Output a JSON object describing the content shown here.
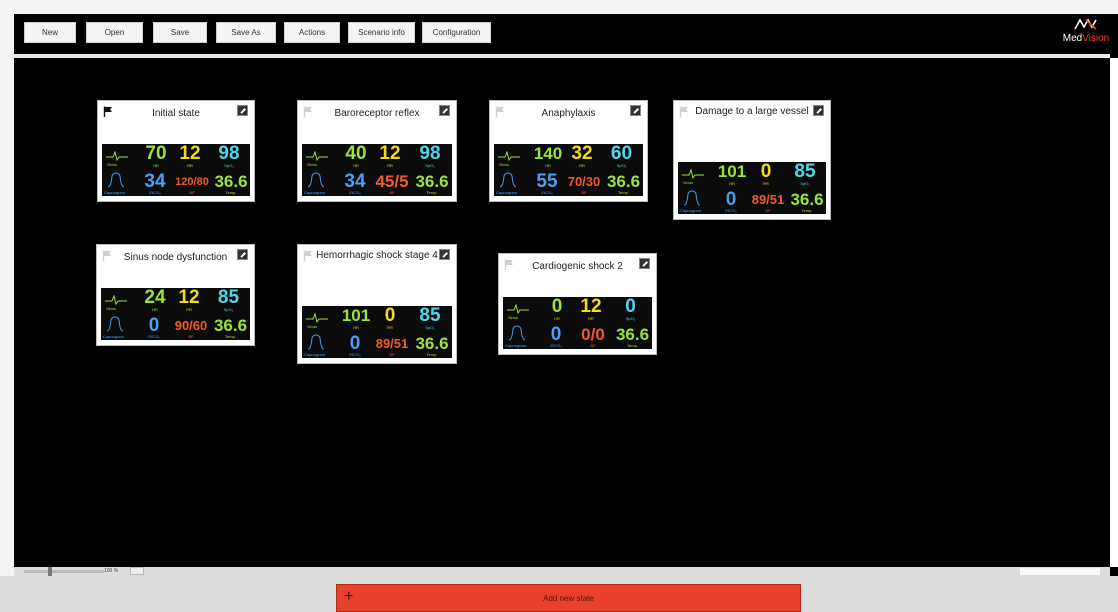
{
  "toolbar": {
    "buttons": [
      "New",
      "Open",
      "Save",
      "Save As",
      "Actions",
      "Scenario info",
      "Configuration"
    ]
  },
  "logo": {
    "text_a": "Med",
    "text_b": "Vision"
  },
  "zoom": {
    "label": "100 %"
  },
  "add_state": {
    "label": "Add new state"
  },
  "monitor_labels": {
    "sinus": "Sinus",
    "capnogram": "Capnogram",
    "hr": "HR",
    "rr": "RR",
    "spo2": "SpO₂",
    "etco2": "EtCO₂",
    "bp": "BP",
    "temp": "Temp."
  },
  "colors": {
    "accent": "#e8402a",
    "hr": "#9be33a",
    "rr": "#f3da1a",
    "spo2": "#4fd6ec",
    "etco2": "#4a9ff5",
    "bp": "#f05a28",
    "temp": "#9be33a"
  },
  "states": [
    {
      "title": "Initial state",
      "flag": "black",
      "hr": "70",
      "rr": "12",
      "spo2": "98",
      "etco2": "34",
      "bp": "120/80",
      "temp": "36.6"
    },
    {
      "title": "Baroreceptor reflex",
      "flag": "grey",
      "hr": "40",
      "rr": "12",
      "spo2": "98",
      "etco2": "34",
      "bp": "45/5",
      "temp": "36.6"
    },
    {
      "title": "Anaphylaxis",
      "flag": "grey",
      "hr": "140",
      "rr": "32",
      "spo2": "60",
      "etco2": "55",
      "bp": "70/30",
      "temp": "36.6"
    },
    {
      "title": "Damage to a large vessel",
      "flag": "grey",
      "hr": "101",
      "rr": "0",
      "spo2": "85",
      "etco2": "0",
      "bp": "89/51",
      "temp": "36.6"
    },
    {
      "title": "Sinus node dysfunction",
      "flag": "grey",
      "hr": "24",
      "rr": "12",
      "spo2": "85",
      "etco2": "0",
      "bp": "90/60",
      "temp": "36.6"
    },
    {
      "title": "Hemorrhagic shock stage 4",
      "flag": "grey",
      "hr": "101",
      "rr": "0",
      "spo2": "85",
      "etco2": "0",
      "bp": "89/51",
      "temp": "36.6"
    },
    {
      "title": "Cardiogenic shock 2",
      "flag": "grey",
      "hr": "0",
      "rr": "12",
      "spo2": "0",
      "etco2": "0",
      "bp": "0/0",
      "temp": "36.6"
    }
  ]
}
